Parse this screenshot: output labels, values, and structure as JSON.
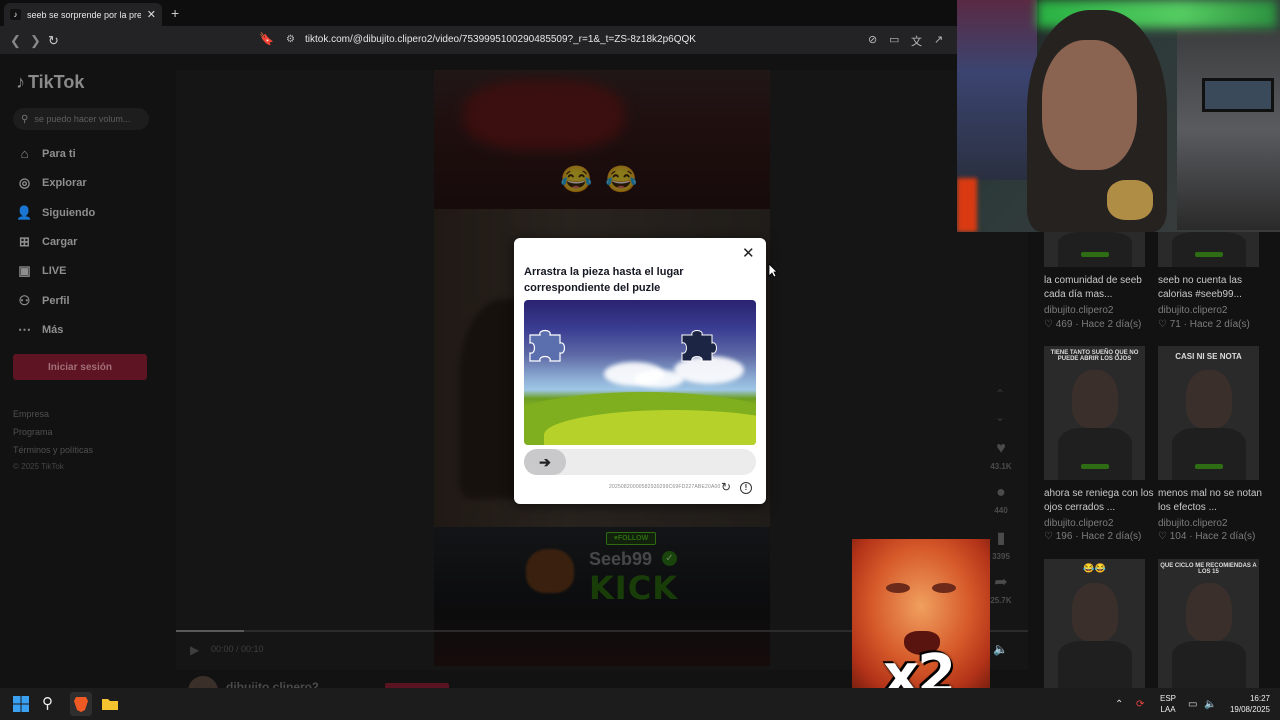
{
  "browser": {
    "tab_title": "seeb se sorprende por la pregunta",
    "tab_favicon": "tiktok-icon",
    "new_tab": "+",
    "close_tab": "✕",
    "url": "tiktok.com/@dibujito.clipero2/video/7539995100290485509?_r=1&_t=ZS-8z18k2p6QQK"
  },
  "sidebar": {
    "logo": "TikTok",
    "search_placeholder": "se puedo hacer volum...",
    "items": [
      {
        "icon": "home-icon",
        "label": "Para ti"
      },
      {
        "icon": "compass-icon",
        "label": "Explorar"
      },
      {
        "icon": "following-icon",
        "label": "Siguiendo"
      },
      {
        "icon": "upload-icon",
        "label": "Cargar"
      },
      {
        "icon": "live-icon",
        "label": "LIVE"
      },
      {
        "icon": "profile-icon",
        "label": "Perfil"
      },
      {
        "icon": "more-icon",
        "label": "Más"
      }
    ],
    "login_button": "Iniciar sesión",
    "footer_links": [
      "Empresa",
      "Programa",
      "Términos y políticas"
    ],
    "copyright": "© 2025 TikTok"
  },
  "video": {
    "overlay_badge": "FOLLOW",
    "overlay_name": "Seeb99",
    "overlay_platform": "KICK",
    "time": "00:00 / 00:10",
    "author": "dibujito.clipero2",
    "progress": 0.08
  },
  "actions": {
    "likes": "43.1K",
    "comments": "440",
    "saves": "3395",
    "shares": "25.7K"
  },
  "captcha": {
    "title": "Arrastra la pieza hasta el lugar correspondiente del puzle",
    "code": "20250820000582930299C69FD227ABE20A00"
  },
  "thumbnails": [
    {
      "title": "la comunidad de seeb cada día mas...",
      "author": "dibujito.clipero2",
      "likes": "469",
      "age": "Hace 2 día(s)",
      "caption": ""
    },
    {
      "title": "seeb no cuenta las calorias #seeb99...",
      "author": "dibujito.clipero2",
      "likes": "71",
      "age": "Hace 2 día(s)",
      "caption": ""
    },
    {
      "title": "ahora se reniega con los ojos cerrados ...",
      "author": "dibujito.clipero2",
      "likes": "196",
      "age": "Hace 2 día(s)",
      "caption": "TIENE TANTO SUEÑO QUE NO PUEDE ABRIR LOS OJOS"
    },
    {
      "title": "menos mal no se notan los efectos ...",
      "author": "dibujito.clipero2",
      "likes": "104",
      "age": "Hace 2 día(s)",
      "caption": "CASI NI SE NOTA"
    },
    {
      "title": "",
      "author": "",
      "likes": "",
      "age": "",
      "caption": ""
    },
    {
      "title": "",
      "author": "",
      "likes": "",
      "age": "",
      "caption": "QUE CICLO ME RECOMIENDAS A LOS 15"
    }
  ],
  "meme_text": "x2",
  "taskbar": {
    "lang_top": "ESP",
    "lang_bottom": "LAA",
    "time": "16:27",
    "date": "19/08/2025"
  }
}
